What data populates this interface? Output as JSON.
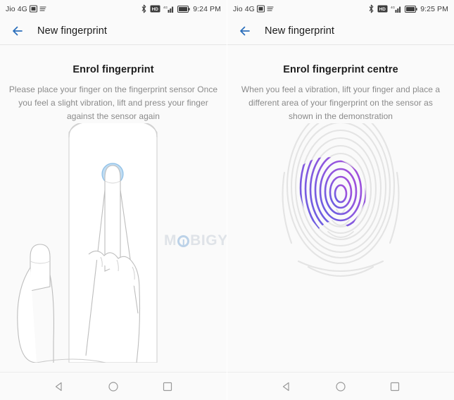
{
  "watermark": {
    "pre": "M",
    "post": "BIGYAAN"
  },
  "panels": [
    {
      "id": "left",
      "status": {
        "carrier": "Jio 4G",
        "time": "9:24 PM",
        "icons": [
          "sim-icon",
          "data-transfer-icon",
          "bluetooth-icon",
          "hd-volte-icon",
          "signal-bars-icon",
          "battery-icon"
        ]
      },
      "appbar": {
        "title": "New fingerprint",
        "back_icon": "back-arrow-icon"
      },
      "headline": "Enrol fingerprint",
      "subtext": "Please place your finger on the fingerprint sensor Once you feel a slight vibration, lift and press your finger against the sensor again",
      "illustration": "phone-with-finger-on-sensor",
      "accent": "#8cc0e8"
    },
    {
      "id": "right",
      "status": {
        "carrier": "Jio 4G",
        "time": "9:25 PM",
        "icons": [
          "sim-icon",
          "data-transfer-icon",
          "bluetooth-icon",
          "hd-volte-icon",
          "signal-bars-icon",
          "battery-icon"
        ]
      },
      "appbar": {
        "title": "New fingerprint",
        "back_icon": "back-arrow-icon"
      },
      "headline": "Enrol fingerprint centre",
      "subtext": "When you feel a vibration, lift your finger and place a different area of your fingerprint on the sensor as shown in the demonstration",
      "illustration": "fingerprint-with-highlighted-region",
      "accent_start": "#a64ddb",
      "accent_end": "#6f6ae0"
    }
  ],
  "navbar": {
    "back": "back-triangle-icon",
    "home": "home-circle-icon",
    "recents": "recents-square-icon"
  },
  "colors": {
    "background": "#fafafa",
    "app_title": "#1a1a1a",
    "headline": "#1d1d1d",
    "subtext": "#8a8a8a",
    "back_arrow": "#2a6ebb",
    "divider": "#e6e6e6",
    "nav_icon": "#9a9a9a",
    "outline": "#c9c9c9",
    "fingerprint_ridge": "#e4e4e4"
  }
}
